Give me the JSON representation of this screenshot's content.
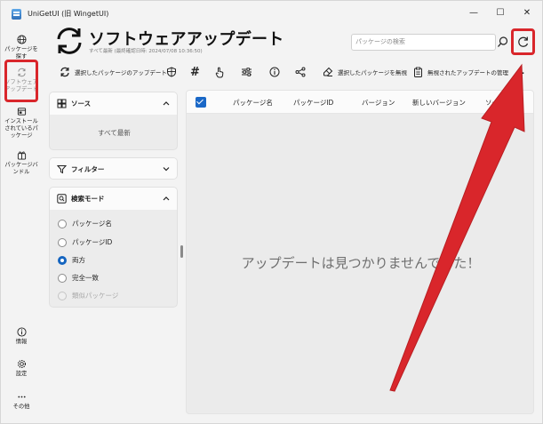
{
  "window": {
    "title": "UniGetUI (旧 WingetUI)",
    "minimize": "—",
    "maximize": "☐",
    "close": "✕"
  },
  "nav": {
    "discover": "パッケージを探す",
    "updates": "ソフトウェアアップデート",
    "installed": "インストールされているパッケージ",
    "bundles": "パッケージバンドル",
    "about": "情報",
    "settings": "設定",
    "more": "その他"
  },
  "header": {
    "title": "ソフトウェアアップデート",
    "subtitle": "すべて最新 (最終確認日時: 2024/07/08 10:36:50)",
    "search_placeholder": "パッケージの検索"
  },
  "toolbar": {
    "update_selected": "選択したパッケージのアップデート",
    "ignore_selected": "選択したパッケージを無視",
    "manage_ignored": "無視されたアップデートの管理",
    "more": "…"
  },
  "sources": {
    "title": "ソース",
    "all_up_to_date": "すべて最新"
  },
  "filters": {
    "title": "フィルター"
  },
  "search_mode": {
    "title": "検索モード",
    "options": [
      "パッケージ名",
      "パッケージID",
      "両方",
      "完全一致",
      "類似パッケージ"
    ],
    "selected": "両方"
  },
  "table": {
    "columns": [
      "パッケージ名",
      "パッケージID",
      "バージョン",
      "新しいバージョン",
      "ソース"
    ],
    "empty_message": "アップデートは見つかりませんでした！"
  },
  "colors": {
    "accent": "#1a68c7",
    "annotation": "#d9262b"
  }
}
